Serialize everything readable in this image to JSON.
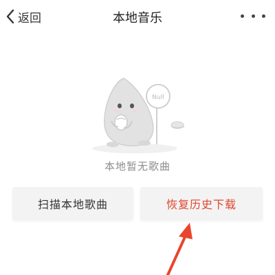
{
  "header": {
    "back_label": "返回",
    "title": "本地音乐",
    "more_icon": "more-dots-icon"
  },
  "empty_state": {
    "illustration": "shrimp-mascot-illustration",
    "sign_text": "Null",
    "message": "本地暂无歌曲"
  },
  "actions": {
    "scan_label": "扫描本地歌曲",
    "restore_label": "恢复历史下载"
  },
  "annotation": {
    "icon": "red-arrow-icon"
  },
  "colors": {
    "accent_red": "#e0462d",
    "button_bg": "#f3f3f3",
    "muted_text": "#8c8c8c"
  }
}
